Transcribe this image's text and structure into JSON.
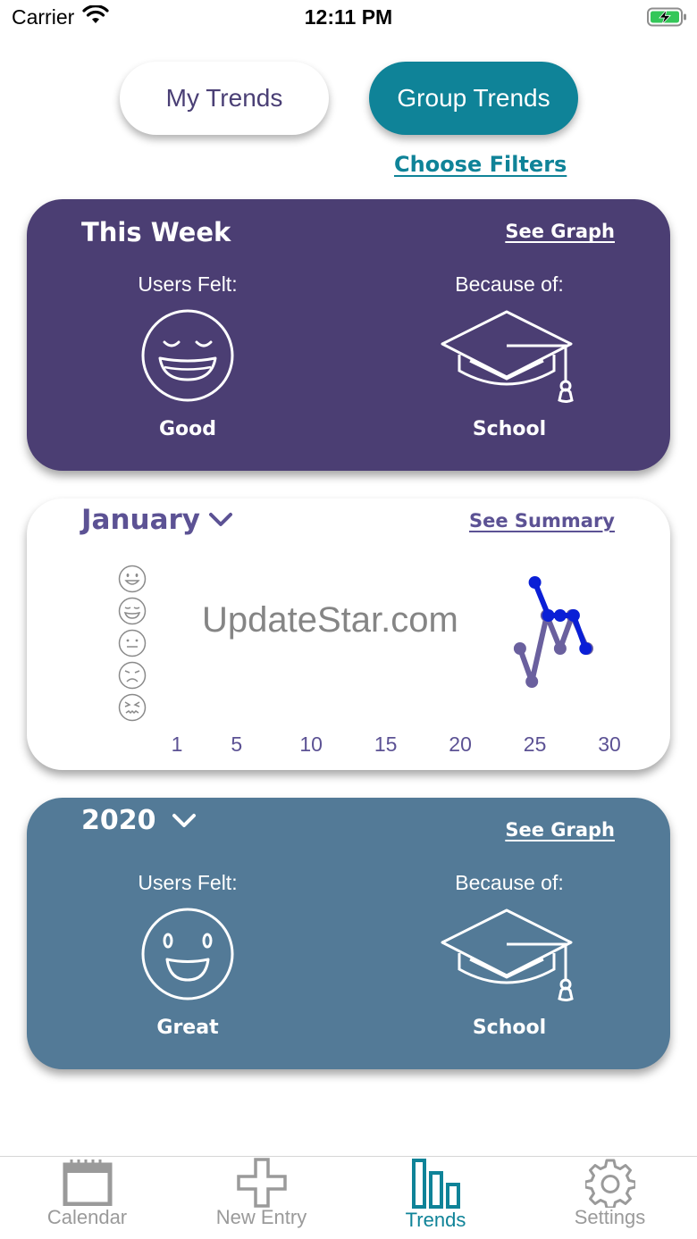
{
  "status_bar": {
    "carrier": "Carrier",
    "time": "12:11 PM"
  },
  "segments": {
    "my_trends": "My Trends",
    "group_trends": "Group Trends",
    "active": "group_trends"
  },
  "filters_link": "Choose Filters",
  "this_week": {
    "title": "This Week",
    "link": "See Graph",
    "felt_label": "Users Felt:",
    "because_label": "Because of:",
    "mood": "Good",
    "mood_icon": "good-face-icon",
    "reason": "School",
    "reason_icon": "graduation-cap-icon"
  },
  "month": {
    "title": "January",
    "link": "See Summary",
    "watermark": "UpdateStar.com",
    "mood_scale_icons": [
      "great-face-icon",
      "good-face-icon",
      "neutral-face-icon",
      "sad-face-icon",
      "awful-face-icon"
    ]
  },
  "year": {
    "title": "2020",
    "link": "See Graph",
    "felt_label": "Users Felt:",
    "because_label": "Because of:",
    "mood": "Great",
    "mood_icon": "great-face-icon",
    "reason": "School",
    "reason_icon": "graduation-cap-icon"
  },
  "chart_data": {
    "type": "line",
    "x_ticks": [
      1,
      5,
      10,
      15,
      20,
      25,
      30
    ],
    "xlim": [
      1,
      30
    ],
    "ylim": [
      1,
      5
    ],
    "y_scale": "mood level, 1 = awful to 5 = great",
    "series": [
      {
        "color": "#6a609e",
        "x": [
          24,
          24.8,
          25.8,
          26.7,
          27.5,
          28.5
        ],
        "y": [
          3,
          2,
          4,
          3,
          4,
          3
        ]
      },
      {
        "color": "#0a1fd6",
        "x": [
          25,
          25.9,
          26.7,
          27.6,
          28.4
        ],
        "y": [
          5,
          4,
          4,
          4,
          3
        ]
      }
    ]
  },
  "tabs": [
    {
      "label": "Calendar",
      "icon": "calendar-icon",
      "active": false
    },
    {
      "label": "New Entry",
      "icon": "plus-icon",
      "active": false
    },
    {
      "label": "Trends",
      "icon": "bar-chart-icon",
      "active": true
    },
    {
      "label": "Settings",
      "icon": "gear-icon",
      "active": false
    }
  ]
}
